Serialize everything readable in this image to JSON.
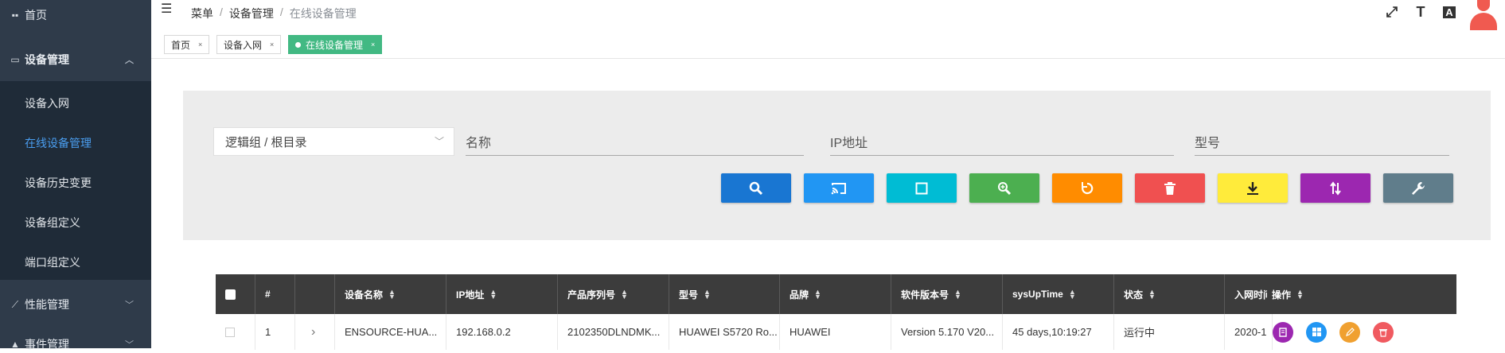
{
  "sidebar": {
    "home": "首页",
    "device_mgmt": "设备管理",
    "sub_items": [
      "设备入网",
      "在线设备管理",
      "设备历史变更",
      "设备组定义",
      "端口组定义"
    ],
    "perf_mgmt": "性能管理",
    "event_mgmt": "事件管理"
  },
  "header": {
    "breadcrumb": [
      "菜单",
      "设备管理",
      "在线设备管理"
    ],
    "sep": "/",
    "text_size_icon": "T",
    "translate_icon": "A"
  },
  "tabs": [
    {
      "label": "首页",
      "close": "×"
    },
    {
      "label": "设备入网",
      "close": "×"
    },
    {
      "label": "在线设备管理",
      "close": "×"
    }
  ],
  "filter": {
    "group_select": "逻辑组 / 根目录",
    "name_placeholder": "名称",
    "ip_placeholder": "IP地址",
    "model_placeholder": "型号"
  },
  "toolbar_colors": {
    "search": "#1976d2",
    "cast": "#2196f3",
    "square": "#00bcd4",
    "zoom": "#4caf50",
    "refresh": "#ff8c00",
    "delete": "#f05050",
    "download": "#ffeb3b",
    "sort": "#9c27b0",
    "settings": "#607d8b"
  },
  "table": {
    "headers": {
      "index": "#",
      "name": "设备名称",
      "ip": "IP地址",
      "serial": "产品序列号",
      "model": "型号",
      "brand": "品牌",
      "version": "软件版本号",
      "uptime": "sysUpTime",
      "status": "状态",
      "join_time": "入网时间",
      "actions": "操作"
    },
    "rows": [
      {
        "index": "1",
        "expand": "›",
        "name": "ENSOURCE-HUA...",
        "ip": "192.168.0.2",
        "serial": "2102350DLNDMK...",
        "model": "HUAWEI S5720 Ro...",
        "brand": "HUAWEI",
        "version": "Version 5.170 V20...",
        "uptime": "45 days,10:19:27",
        "status": "运行中",
        "join_time": "2020-1"
      }
    ]
  }
}
